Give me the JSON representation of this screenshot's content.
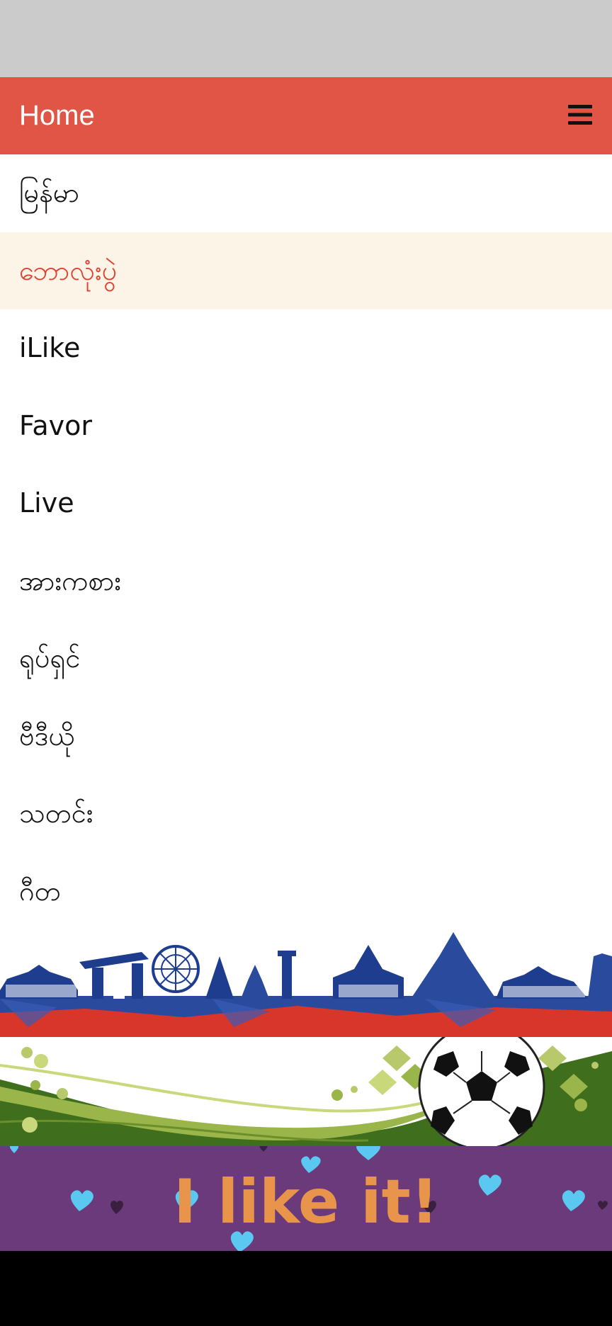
{
  "header": {
    "title": "Home",
    "menu_icon": "hamburger-menu-icon"
  },
  "nav": {
    "items": [
      {
        "label": "မြန်မာ",
        "active": false
      },
      {
        "label": "ဘောလုံးပွဲ",
        "active": true
      },
      {
        "label": "iLike",
        "active": false
      },
      {
        "label": "Favor",
        "active": false
      },
      {
        "label": "Live",
        "active": false
      },
      {
        "label": "အားကစား",
        "active": false
      },
      {
        "label": "ရုပ်ရှင်",
        "active": false
      },
      {
        "label": "ဗီဒီယို",
        "active": false
      },
      {
        "label": "သတင်း",
        "active": false
      },
      {
        "label": "ဂီတ",
        "active": false
      }
    ]
  },
  "banners": {
    "ilike_text": "I like it!"
  },
  "colors": {
    "status_bar": "#cbcbcb",
    "header": "#e05546",
    "active_bg": "#fdf4e8",
    "active_text": "#e0412f",
    "banner_purple": "#6a3a7a"
  }
}
